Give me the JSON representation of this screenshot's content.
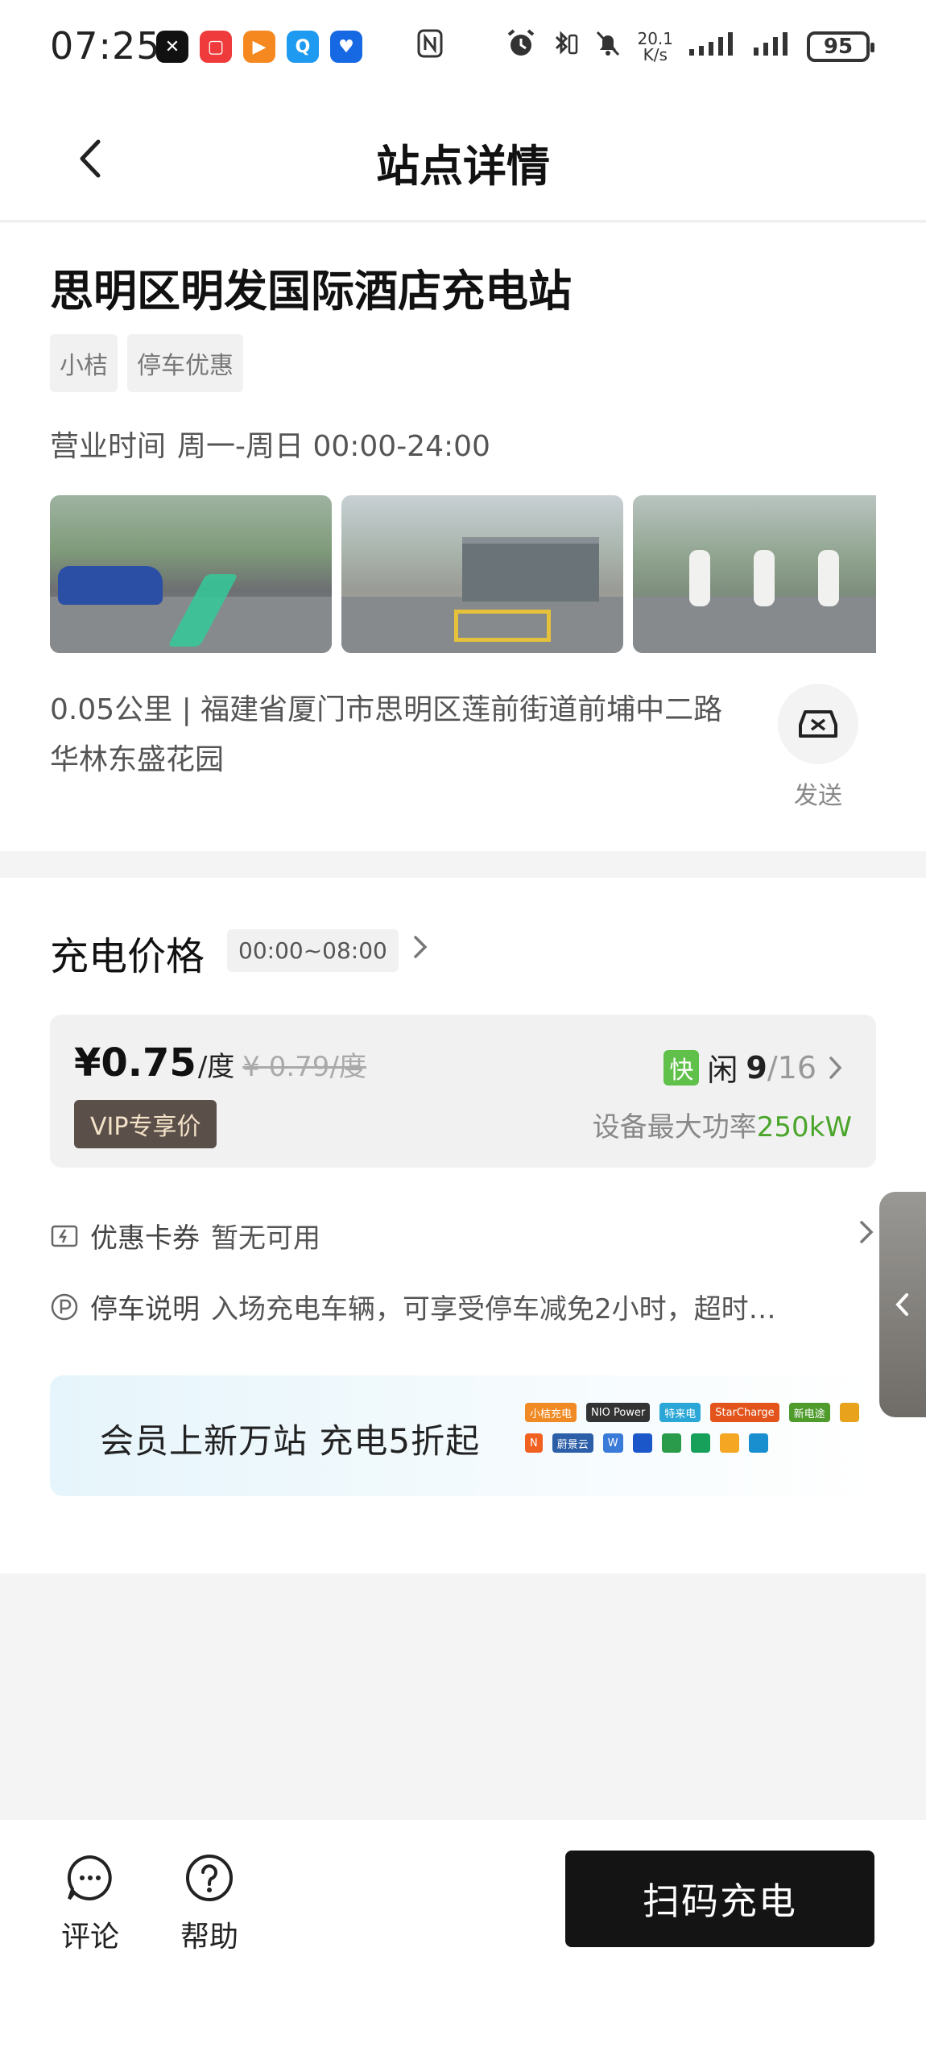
{
  "status_bar": {
    "time": "07:25",
    "net_speed_value": "20.1",
    "net_speed_unit": "K/s",
    "battery": "95",
    "app_icons": [
      {
        "name": "capcut-icon",
        "color": "#111111",
        "glyph": "✕"
      },
      {
        "name": "red-app-icon",
        "color": "#ef3b3b",
        "glyph": "▢"
      },
      {
        "name": "orange-play-icon",
        "color": "#f5891f",
        "glyph": "▶"
      },
      {
        "name": "search-app-icon",
        "color": "#1e9bf0",
        "glyph": "Q"
      },
      {
        "name": "bulb-app-icon",
        "color": "#1668e3",
        "glyph": "♥"
      }
    ]
  },
  "header": {
    "title": "站点详情"
  },
  "station": {
    "name": "思明区明发国际酒店充电站",
    "tags": [
      "小桔",
      "停车优惠"
    ],
    "hours_label": "营业时间",
    "hours_value": "周一-周日 00:00-24:00",
    "address": "0.05公里 | 福建省厦门市思明区莲前街道前埔中二路华林东盛花园",
    "send_label": "发送"
  },
  "pricing": {
    "title": "充电价格",
    "time_range": "00:00~08:00",
    "price": "¥0.75",
    "unit": "/度",
    "original_price": "¥ 0.79/度",
    "vip_label": "VIP专享价",
    "fast_badge": "快",
    "idle_label": "闲",
    "idle_count": "9",
    "total_count": "/16",
    "power_label": "设备最大功率",
    "power_value": "250kW",
    "coupon_label": "优惠卡券",
    "coupon_value": "暂无可用",
    "parking_label": "停车说明",
    "parking_value": "入场充电车辆，可享受停车减免2小时，超时…",
    "banner_text": "会员上新万站 充电5折起",
    "partner_logos": [
      {
        "text": "小桔充电",
        "color": "#f08a24"
      },
      {
        "text": "NIO Power",
        "color": "#333333"
      },
      {
        "text": "特来电",
        "color": "#2aa7d6"
      },
      {
        "text": "StarCharge",
        "color": "#e2541b"
      },
      {
        "text": "新电途",
        "color": "#4f9b2c"
      },
      {
        "text": "",
        "color": "#e8a21c"
      },
      {
        "text": "N",
        "color": "#f06020"
      },
      {
        "text": "蔚景云",
        "color": "#2c5fa8"
      },
      {
        "text": "W",
        "color": "#3a7ad8"
      },
      {
        "text": "",
        "color": "#1b57c9"
      },
      {
        "text": "",
        "color": "#2a9a4b"
      },
      {
        "text": "",
        "color": "#17a05a"
      },
      {
        "text": "",
        "color": "#f5a623"
      },
      {
        "text": "",
        "color": "#1a8fd0"
      }
    ]
  },
  "bottom": {
    "comment_label": "评论",
    "help_label": "帮助",
    "scan_button": "扫码充电"
  }
}
